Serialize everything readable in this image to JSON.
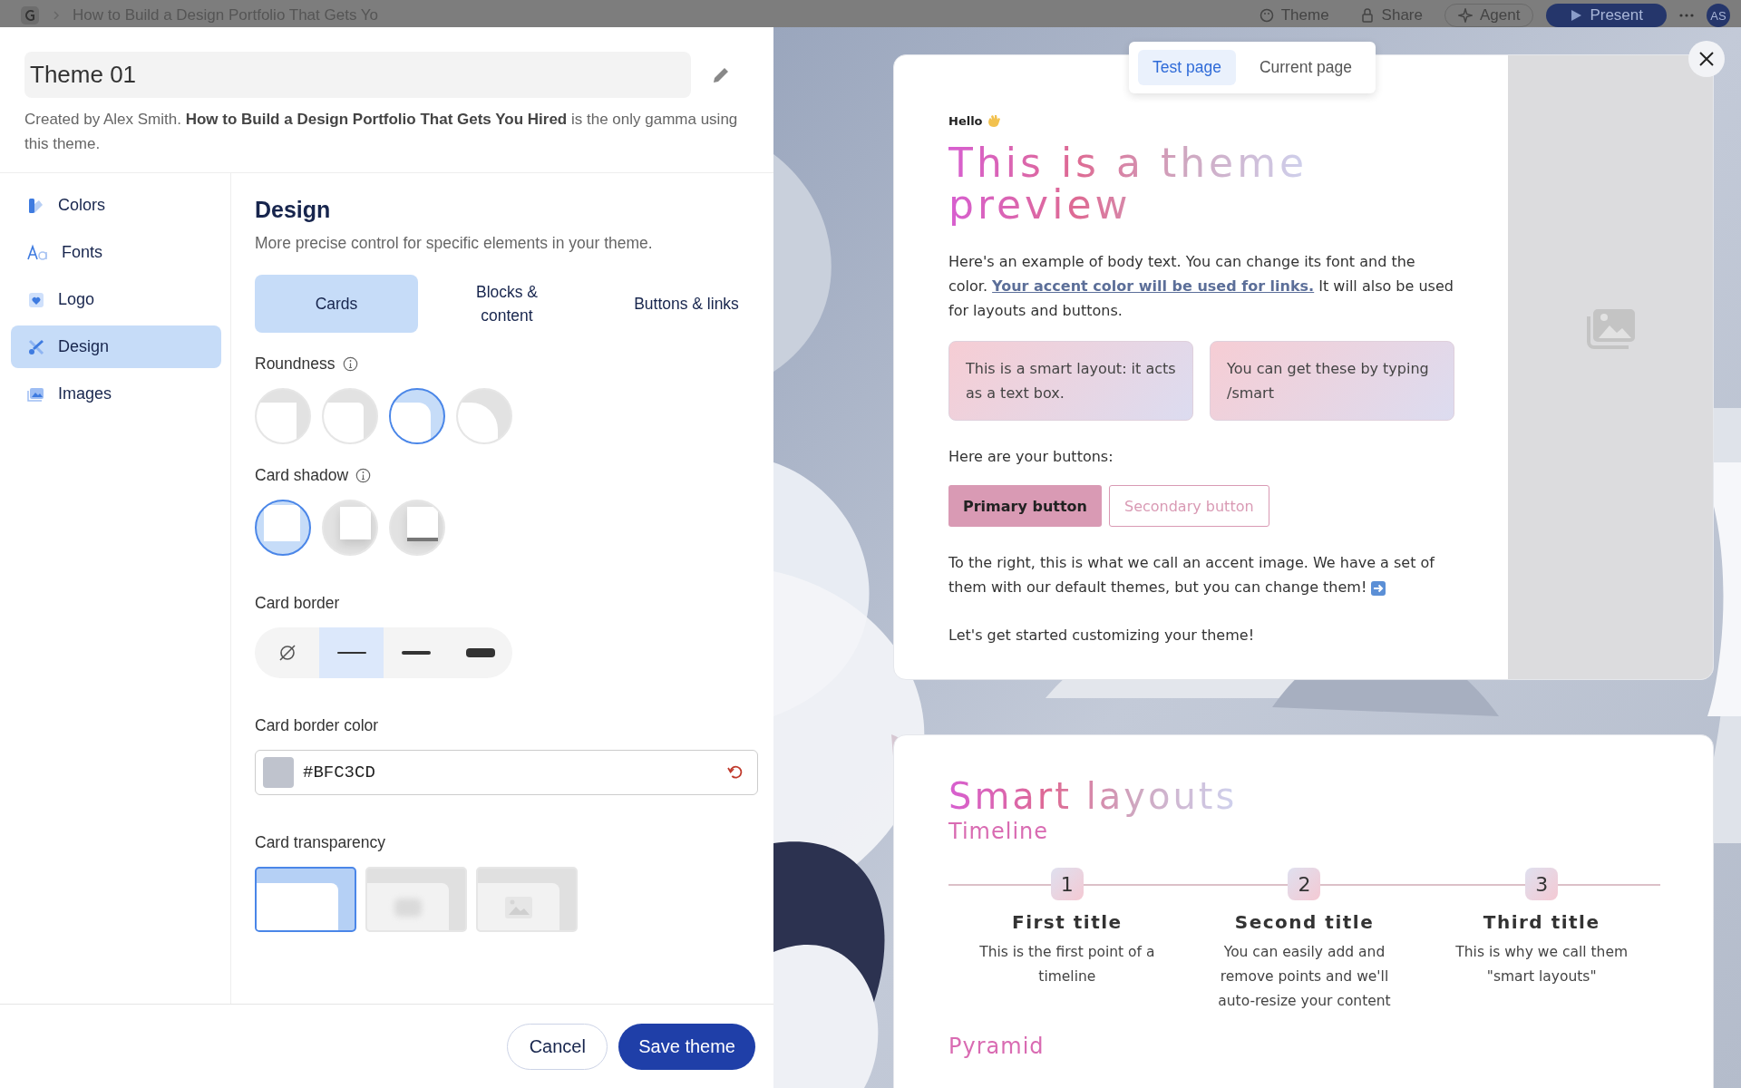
{
  "app_bar": {
    "document_title": "How to Build a Design Portfolio That Gets Yo",
    "actions": [
      {
        "label": "Theme",
        "kind": "theme"
      },
      {
        "label": "Share",
        "kind": "share"
      },
      {
        "label": "Agent",
        "kind": "agent"
      },
      {
        "label": "Present",
        "kind": "present"
      }
    ],
    "avatar": "AS"
  },
  "editor": {
    "theme_name": "Theme 01",
    "description": "Created by Alex Smith. **How to Build a Design Portfolio That Gets You Hired** is the only gamma using this theme.",
    "nav": [
      {
        "label": "Colors",
        "kind": "colors",
        "selected": false
      },
      {
        "label": "Fonts",
        "kind": "fonts",
        "selected": false
      },
      {
        "label": "Logo",
        "kind": "logo",
        "selected": false
      },
      {
        "label": "Design",
        "kind": "design",
        "selected": true
      },
      {
        "label": "Images",
        "kind": "images",
        "selected": false
      }
    ],
    "section": {
      "title": "Design",
      "subtitle": "More precise control for specific elements in your theme.",
      "tabs": [
        {
          "label": "Cards",
          "selected": true
        },
        {
          "label": "Blocks & content",
          "selected": false
        },
        {
          "label": "Buttons & links",
          "selected": false
        }
      ],
      "roundness": {
        "label": "Roundness",
        "options": [
          {
            "kind": "square",
            "selected": false
          },
          {
            "kind": "slight",
            "selected": false
          },
          {
            "kind": "rounded",
            "selected": true
          },
          {
            "kind": "round",
            "selected": false
          }
        ]
      },
      "card_shadow": {
        "label": "Card shadow",
        "options": [
          {
            "kind": "none",
            "selected": true
          },
          {
            "kind": "soft",
            "selected": false
          },
          {
            "kind": "hard",
            "selected": false
          }
        ]
      },
      "card_border": {
        "label": "Card border",
        "options": [
          {
            "kind": "none",
            "selected": false
          },
          {
            "kind": "thin",
            "selected": true
          },
          {
            "kind": "medium",
            "selected": false
          },
          {
            "kind": "thick",
            "selected": false
          }
        ]
      },
      "card_border_color": {
        "label": "Card border color",
        "value": "#BFC3CD",
        "color": "#bfc3cd"
      },
      "card_transparency": {
        "label": "Card transparency",
        "options": [
          {
            "kind": "solid",
            "selected": true
          },
          {
            "kind": "frosted",
            "selected": false
          },
          {
            "kind": "clear",
            "selected": false
          }
        ]
      }
    },
    "buttons": [
      {
        "label": "Cancel",
        "kind": "secondary"
      },
      {
        "label": "Save theme",
        "kind": "primary"
      }
    ]
  },
  "preview": {
    "tabs": [
      {
        "label": "Test page",
        "selected": true
      },
      {
        "label": "Current page",
        "selected": false
      }
    ],
    "card": {
      "greeting": "Hello",
      "title": "This is a theme preview",
      "body_intro": "Here's an example of body text. You can change its font and the color.",
      "link": "Your accent color will be used for links.",
      "body_after": "It will also be used for layouts and buttons.",
      "smart_boxes": [
        "This is a smart layout: it acts as a text box.",
        "You can get these by typing /smart"
      ],
      "buttons_label": "Here are your buttons:",
      "buttons": [
        {
          "label": "Primary button",
          "kind": "primary"
        },
        {
          "label": "Secondary button",
          "kind": "secondary"
        }
      ],
      "accent_text": "To the right, this is what we call an accent image. We have a set of them with our default themes, but you can change them!",
      "closing": "Let's get started customizing your theme!"
    },
    "second_card": {
      "title": "Smart layouts",
      "subtitle": "Timeline",
      "steps": [
        {
          "number": "1",
          "title": "First title",
          "text": "This is the first point of a timeline"
        },
        {
          "number": "2",
          "title": "Second title",
          "text": "You can easily add and remove points and we'll auto-resize your content"
        },
        {
          "number": "3",
          "title": "Third title",
          "text": "This is why we call them \"smart layouts\""
        }
      ],
      "next_heading": "Pyramid"
    }
  }
}
